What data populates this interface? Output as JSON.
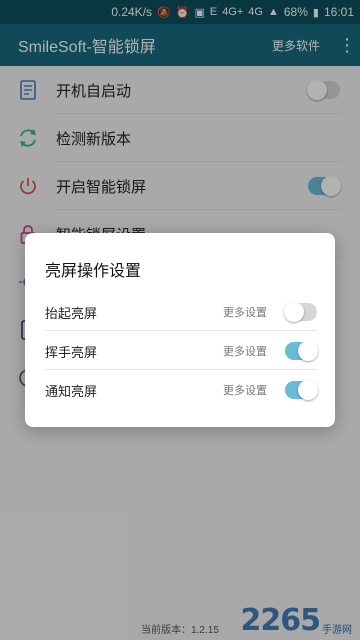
{
  "status_bar": {
    "speed": "0.24K/s",
    "sim": "E",
    "net1": "4G+",
    "net2": "4G",
    "battery": "68%",
    "time": "16:01"
  },
  "app_bar": {
    "title": "SmileSoft-智能锁屏",
    "more_software": "更多软件"
  },
  "settings_list": [
    {
      "label": "开机自启动",
      "icon": "document-list-icon",
      "toggle": false
    },
    {
      "label": "检测新版本",
      "icon": "refresh-icon"
    },
    {
      "label": "开启智能锁屏",
      "icon": "power-icon",
      "toggle": true
    },
    {
      "label": "智能锁屏设置",
      "icon": "lock-icon"
    }
  ],
  "dialog": {
    "title": "亮屏操作设置",
    "items": [
      {
        "label": "抬起亮屏",
        "more": "更多设置",
        "enabled": false
      },
      {
        "label": "挥手亮屏",
        "more": "更多设置",
        "enabled": true
      },
      {
        "label": "通知亮屏",
        "more": "更多设置",
        "enabled": true
      }
    ]
  },
  "footer": {
    "version": "当前版本：1.2.15"
  },
  "watermark": {
    "number": "2265",
    "text": "手游网"
  },
  "colors": {
    "status_bar": "#0e4f5e",
    "app_bar": "#176a7f",
    "toggle_on": "#69bcd6",
    "toggle_off": "#d6d6d6"
  }
}
